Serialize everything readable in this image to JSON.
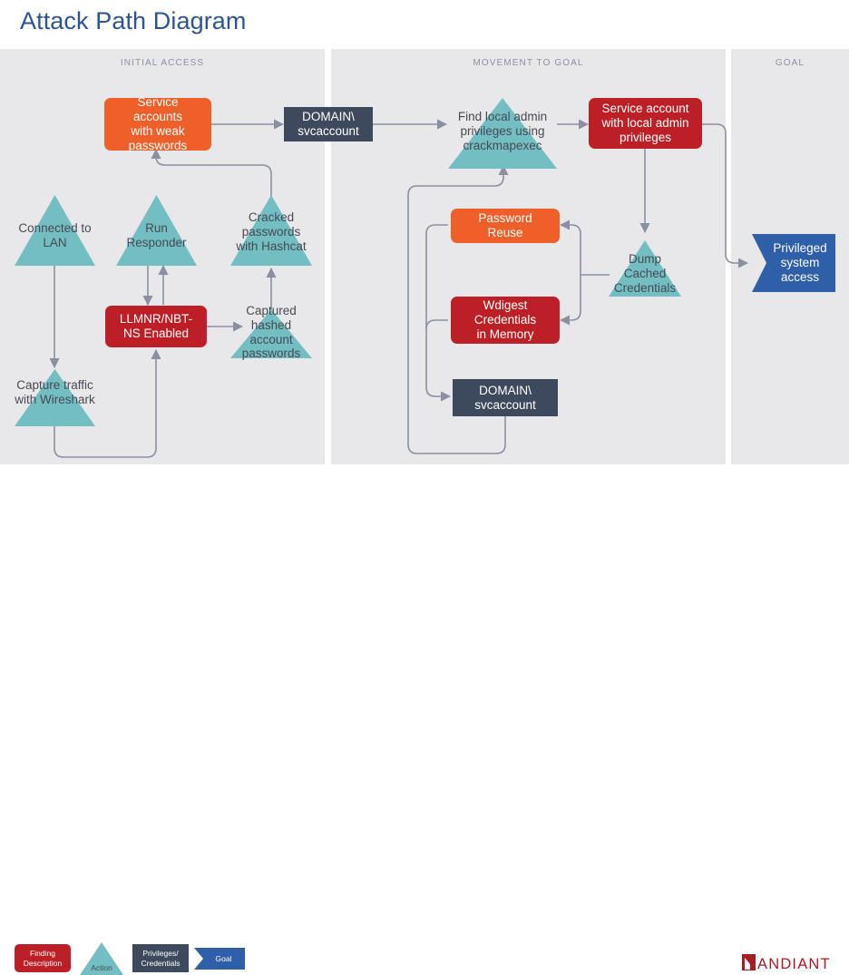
{
  "header": {
    "title": "Attack Path Diagram"
  },
  "lanes": [
    {
      "id": "initial-access",
      "label": "INITIAL ACCESS"
    },
    {
      "id": "movement-to-goal",
      "label": "MOVEMENT TO GOAL"
    },
    {
      "id": "goal",
      "label": "GOAL"
    }
  ],
  "nodes": {
    "service_accounts_weak": {
      "label": "Service accounts with weak passwords",
      "type": "finding-orange"
    },
    "domain_svcaccount_top": {
      "label": "DOMAIN\\ svcaccount",
      "type": "privileges-credentials"
    },
    "find_local_admin": {
      "label": "Find local admin privileges using crackmapexec",
      "type": "action"
    },
    "service_account_admin": {
      "label": "Service account with local admin privileges",
      "type": "finding"
    },
    "connected_to_lan": {
      "label": "Connected to LAN",
      "type": "action"
    },
    "run_responder": {
      "label": "Run Responder",
      "type": "action"
    },
    "cracked_passwords": {
      "label": "Cracked passwords with Hashcat",
      "type": "action"
    },
    "llmnr_nbtns": {
      "label": "LLMNR/NBT-NS Enabled",
      "type": "finding"
    },
    "captured_hashes": {
      "label": "Captured hashed account passwords",
      "type": "action"
    },
    "capture_wireshark": {
      "label": "Capture traffic with Wireshark",
      "type": "action"
    },
    "password_reuse": {
      "label": "Password Reuse",
      "type": "finding-orange"
    },
    "wdigest_credentials": {
      "label": "Wdigest Credentials in Memory",
      "type": "finding"
    },
    "dump_cached_credentials": {
      "label": "Dump Cached Credentials",
      "type": "action"
    },
    "domain_svcaccount_mid": {
      "label": "DOMAIN\\ svcaccount",
      "type": "privileges-credentials"
    },
    "privileged_system_access": {
      "label": "Privileged system access",
      "type": "goal"
    }
  },
  "node_text": {
    "service_accounts_weak_l1": "Service accounts",
    "service_accounts_weak_l2": "with weak",
    "service_accounts_weak_l3": "passwords",
    "domain_top_l1": "DOMAIN\\",
    "domain_top_l2": "svcaccount",
    "find_local_admin_l1": "Find local admin",
    "find_local_admin_l2": "privileges using",
    "find_local_admin_l3": "crackmapexec",
    "service_account_admin_l1": "Service account",
    "service_account_admin_l2": "with local admin",
    "service_account_admin_l3": "privileges",
    "connected_l1": "Connected",
    "connected_l2": "to LAN",
    "responder_l1": "Run",
    "responder_l2": "Responder",
    "cracked_l1": "Cracked",
    "cracked_l2": "passwords",
    "cracked_l3": "with Hashcat",
    "llmnr_l1": "LLMNR/NBT-",
    "llmnr_l2": "NS Enabled",
    "captured_l1": "Captured",
    "captured_l2": "hashed",
    "captured_l3": "account",
    "captured_l4": "passwords",
    "wireshark_l1": "Capture",
    "wireshark_l2": "traffic with",
    "wireshark_l3": "Wireshark",
    "password_reuse_l1": "Password",
    "password_reuse_l2": "Reuse",
    "wdigest_l1": "Wdigest",
    "wdigest_l2": "Credentials",
    "wdigest_l3": "in Memory",
    "dump_l1": "Dump",
    "dump_l2": "Cached",
    "dump_l3": "Credentials",
    "domain_mid_l1": "DOMAIN\\",
    "domain_mid_l2": "svcaccount",
    "goal_l1": "Privileged",
    "goal_l2": "system",
    "goal_l3": "access"
  },
  "legend": {
    "finding_l1": "Finding",
    "finding_l2": "Description",
    "action": "Action",
    "credentials_l1": "Privileges/",
    "credentials_l2": "Credentials",
    "goal": "Goal"
  },
  "logo": {
    "text": "ANDIANT"
  },
  "colors": {
    "title": "#2f5496",
    "lane_bg": "#e8e8ea",
    "lane_label": "#8c90a0",
    "finding_red": "#bc2026",
    "finding_orange": "#ef5f29",
    "action_teal": "#72bec3",
    "credentials_navy": "#3d4a5d",
    "goal_blue": "#2f5fa8",
    "connector": "#8a90a2",
    "node_text_dark": "#474a52",
    "logo_red": "#a51c22"
  }
}
